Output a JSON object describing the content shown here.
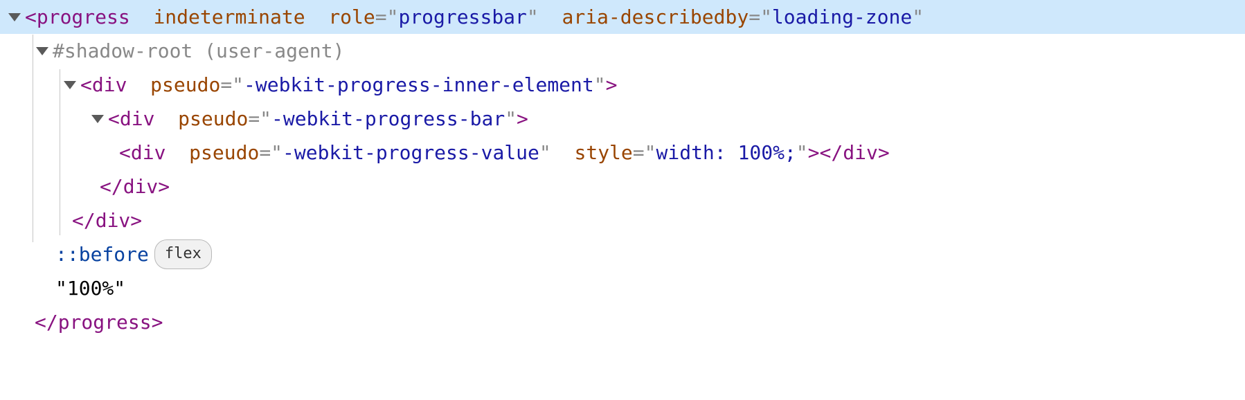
{
  "line0": {
    "bracket_open": "<",
    "tag": "progress",
    "attr1": "indeterminate",
    "attr2": "role",
    "val2": "progressbar",
    "attr3": "aria-describedby",
    "val3": "loading-zone"
  },
  "line1": {
    "text": "#shadow-root (user-agent)"
  },
  "line2": {
    "bracket_open": "<",
    "tag": "div",
    "attr": "pseudo",
    "val": "-webkit-progress-inner-element",
    "bracket_close": ">"
  },
  "line3": {
    "bracket_open": "<",
    "tag": "div",
    "attr": "pseudo",
    "val": "-webkit-progress-bar",
    "bracket_close": ">"
  },
  "line4": {
    "bracket_open": "<",
    "tag": "div",
    "attr1": "pseudo",
    "val1": "-webkit-progress-value",
    "attr2": "style",
    "val2": "width: 100%;",
    "close": "></",
    "close_tag": "div",
    "close_end": ">"
  },
  "line5": {
    "open": "</",
    "tag": "div",
    "close": ">"
  },
  "line6": {
    "open": "</",
    "tag": "div",
    "close": ">"
  },
  "line7": {
    "pseudo": "::before",
    "badge": "flex"
  },
  "line8": {
    "text": "\"100%\""
  },
  "line9": {
    "open": "</",
    "tag": "progress",
    "close": ">"
  },
  "syntax": {
    "eq": "=",
    "quote": "\""
  }
}
